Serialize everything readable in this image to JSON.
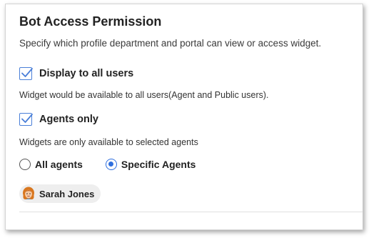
{
  "panel": {
    "title": "Bot Access Permission",
    "subtitle": "Specify which profile department and portal can view or access widget."
  },
  "options": {
    "display_all": {
      "label": "Display to all users",
      "checked": true,
      "description": "Widget would be available to all users(Agent and Public users)."
    },
    "agents_only": {
      "label": "Agents only",
      "checked": true,
      "description": "Widgets are only available to selected agents"
    }
  },
  "agent_scope": {
    "options": [
      {
        "label": "All agents",
        "selected": false
      },
      {
        "label": "Specific Agents",
        "selected": true
      }
    ]
  },
  "selected_agents": [
    {
      "name": "Sarah Jones",
      "avatar_icon": "female-avatar-icon"
    }
  ],
  "colors": {
    "accent": "#2f6fde",
    "checkbox_border": "#4a7fd8",
    "chip_bg": "#eeeeee"
  }
}
